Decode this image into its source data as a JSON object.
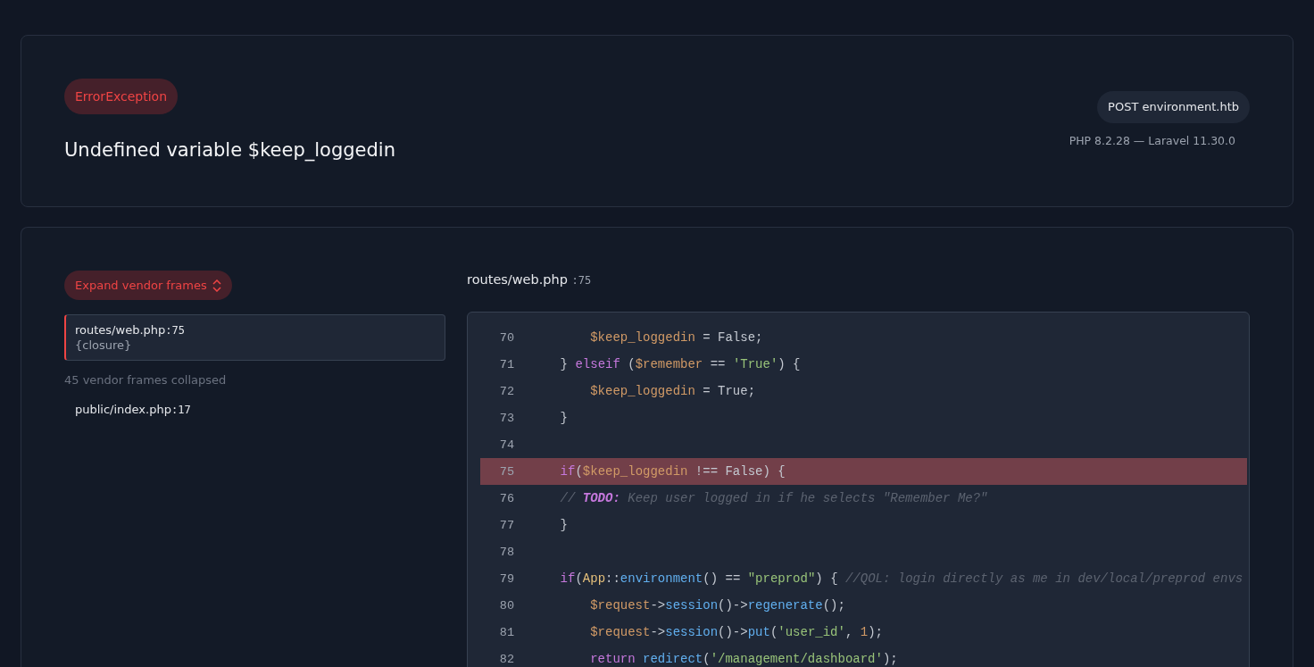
{
  "exception": {
    "type": "ErrorException",
    "message": "Undefined variable $keep_loggedin",
    "request": "POST environment.htb",
    "versions": "PHP 8.2.28 — Laravel 11.30.0"
  },
  "sidebar": {
    "expand_button": "Expand vendor frames",
    "frames": [
      {
        "file": "routes/web.php",
        "line": ":75",
        "function": "{closure}",
        "selected": true
      }
    ],
    "collapsed_note": "45 vendor frames collapsed",
    "more_frames": [
      {
        "file": "public/index.php",
        "line": ":17",
        "selected": false
      }
    ]
  },
  "code": {
    "file": "routes/web.php",
    "line": ":75",
    "lines": [
      {
        "number": "70",
        "highlighted": false,
        "tokens": [
          {
            "kind": "var",
            "text": "        $keep_loggedin"
          },
          {
            "kind": "plain",
            "text": " = False;"
          }
        ]
      },
      {
        "number": "71",
        "highlighted": false,
        "tokens": [
          {
            "kind": "plain",
            "text": "    } "
          },
          {
            "kind": "kw",
            "text": "elseif"
          },
          {
            "kind": "plain",
            "text": " ("
          },
          {
            "kind": "var",
            "text": "$remember"
          },
          {
            "kind": "plain",
            "text": " == "
          },
          {
            "kind": "str",
            "text": "'True'"
          },
          {
            "kind": "plain",
            "text": ") {"
          }
        ]
      },
      {
        "number": "72",
        "highlighted": false,
        "tokens": [
          {
            "kind": "var",
            "text": "        $keep_loggedin"
          },
          {
            "kind": "plain",
            "text": " = True;"
          }
        ]
      },
      {
        "number": "73",
        "highlighted": false,
        "tokens": [
          {
            "kind": "plain",
            "text": "    }"
          }
        ]
      },
      {
        "number": "74",
        "highlighted": false
      },
      {
        "number": "75",
        "highlighted": true,
        "tokens": [
          {
            "kind": "kw",
            "text": "    if"
          },
          {
            "kind": "plain",
            "text": "("
          },
          {
            "kind": "var",
            "text": "$keep_loggedin"
          },
          {
            "kind": "plain",
            "text": " !== False) {"
          }
        ]
      },
      {
        "number": "76",
        "highlighted": false,
        "tokens": [
          {
            "kind": "comment",
            "text": "    // "
          },
          {
            "kind": "todo",
            "text": "TODO:"
          },
          {
            "kind": "comment",
            "text": " Keep user logged in if he selects \"Remember Me?\""
          }
        ]
      },
      {
        "number": "77",
        "highlighted": false,
        "tokens": [
          {
            "kind": "plain",
            "text": "    }"
          }
        ]
      },
      {
        "number": "78",
        "highlighted": false
      },
      {
        "number": "79",
        "highlighted": false,
        "tokens": [
          {
            "kind": "kw",
            "text": "    if"
          },
          {
            "kind": "plain",
            "text": "("
          },
          {
            "kind": "cls",
            "text": "App"
          },
          {
            "kind": "plain",
            "text": "::"
          },
          {
            "kind": "fn",
            "text": "environment"
          },
          {
            "kind": "plain",
            "text": "() == "
          },
          {
            "kind": "str",
            "text": "\"preprod\""
          },
          {
            "kind": "plain",
            "text": ") { "
          },
          {
            "kind": "comment",
            "text": "//QOL: login directly as me in dev/local/preprod envs"
          }
        ]
      },
      {
        "number": "80",
        "highlighted": false,
        "tokens": [
          {
            "kind": "var",
            "text": "        $request"
          },
          {
            "kind": "plain",
            "text": "->"
          },
          {
            "kind": "fn",
            "text": "session"
          },
          {
            "kind": "plain",
            "text": "()->"
          },
          {
            "kind": "fn",
            "text": "regenerate"
          },
          {
            "kind": "plain",
            "text": "();"
          }
        ]
      },
      {
        "number": "81",
        "highlighted": false,
        "tokens": [
          {
            "kind": "var",
            "text": "        $request"
          },
          {
            "kind": "plain",
            "text": "->"
          },
          {
            "kind": "fn",
            "text": "session"
          },
          {
            "kind": "plain",
            "text": "()->"
          },
          {
            "kind": "fn",
            "text": "put"
          },
          {
            "kind": "plain",
            "text": "("
          },
          {
            "kind": "str",
            "text": "'user_id'"
          },
          {
            "kind": "plain",
            "text": ", "
          },
          {
            "kind": "num",
            "text": "1"
          },
          {
            "kind": "plain",
            "text": ");"
          }
        ]
      },
      {
        "number": "82",
        "highlighted": false,
        "tokens": [
          {
            "kind": "kw",
            "text": "        return "
          },
          {
            "kind": "fn",
            "text": "redirect"
          },
          {
            "kind": "plain",
            "text": "("
          },
          {
            "kind": "str",
            "text": "'/management/dashboard'"
          },
          {
            "kind": "plain",
            "text": ");"
          }
        ]
      }
    ]
  }
}
